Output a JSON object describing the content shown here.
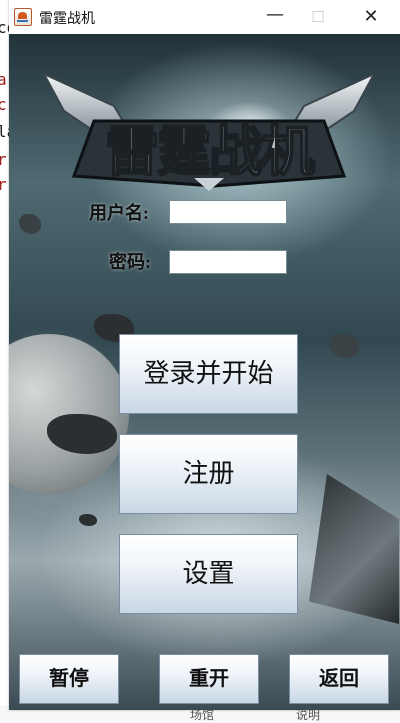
{
  "window": {
    "title": "雷霆战机"
  },
  "logo": {
    "text": "雷霆战机"
  },
  "form": {
    "username_label": "用户名:",
    "username_value": "",
    "password_label": "密码:",
    "password_value": ""
  },
  "buttons": {
    "login_start": "登录并开始",
    "register": "注册",
    "settings": "设置",
    "pause": "暂停",
    "restart": "重开",
    "back": "返回"
  },
  "background_peek": {
    "left_letters": [
      "co",
      "a",
      "c",
      "la",
      "r",
      "r"
    ],
    "bottom_left": "场馆",
    "bottom_right": "说明"
  }
}
